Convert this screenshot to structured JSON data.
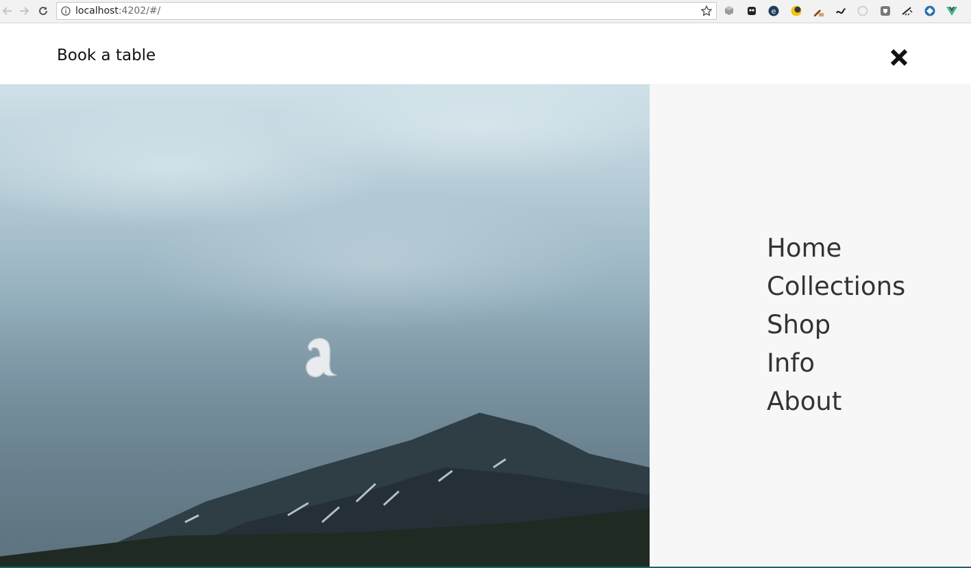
{
  "browser": {
    "url_host": "localhost",
    "url_rest": ":4202/#/",
    "extensions": [
      "cube-icon",
      "ghost-icon",
      "e-icon",
      "moon-icon",
      "eyedropper-icon",
      "snake-icon",
      "circle-icon",
      "shield-icon",
      "ruler-icon",
      "diamond-icon",
      "vue-icon"
    ]
  },
  "header": {
    "book_label": "Book a table",
    "close_icon": "close-x-icon"
  },
  "menu": {
    "items": [
      "Home",
      "Collections",
      "Shop",
      "Info",
      "About"
    ]
  },
  "colors": {
    "menu_background": "#f7f7f7",
    "menu_text": "#333333",
    "accent_bottom": "#1f5f70"
  }
}
